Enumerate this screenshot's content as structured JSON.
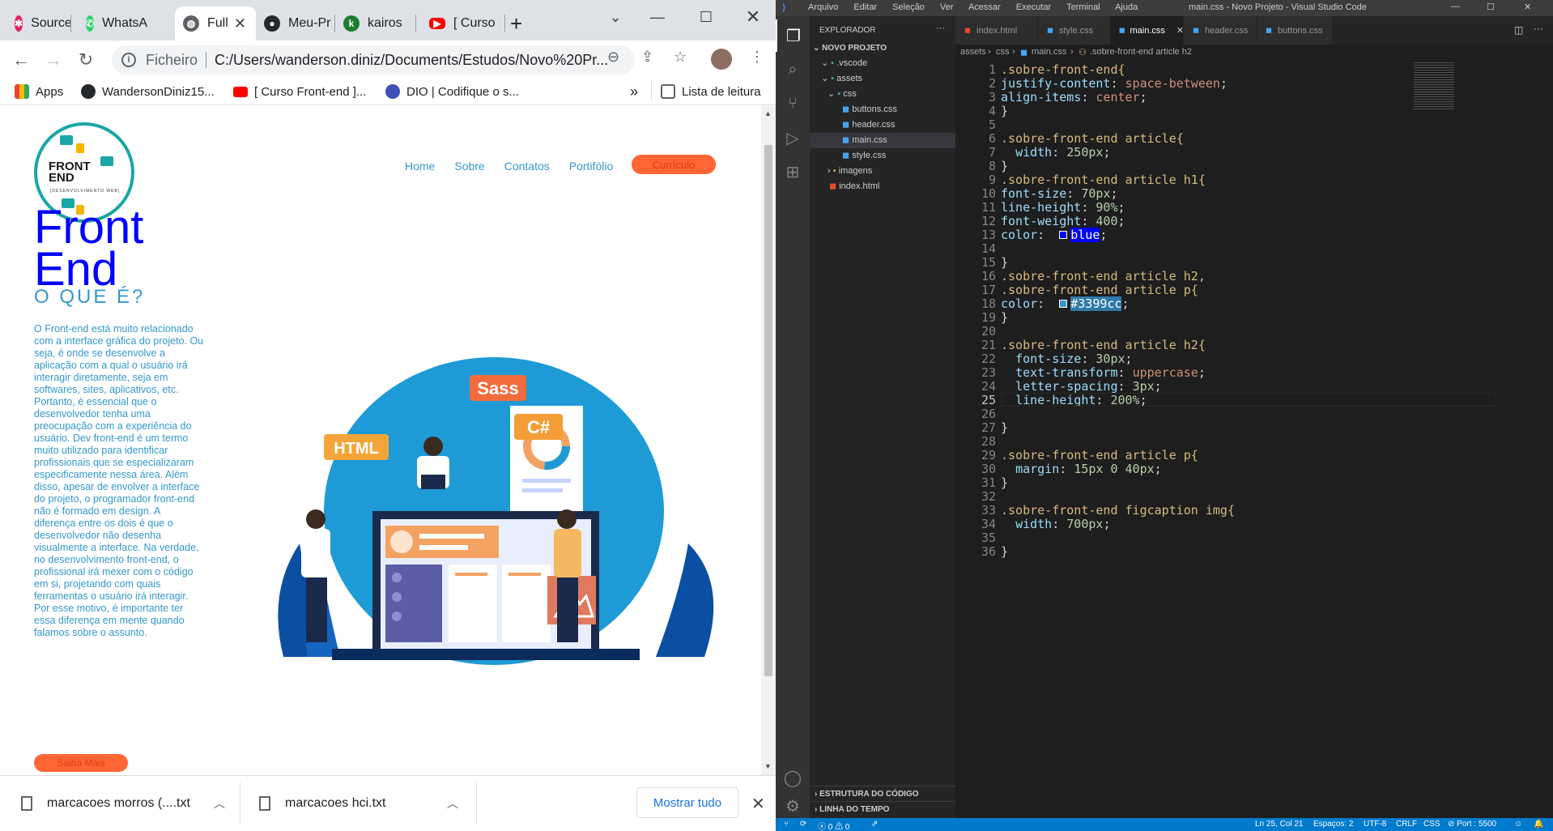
{
  "chrome": {
    "tabs": [
      {
        "label": "Source",
        "favicon": "slack-icon"
      },
      {
        "label": "WhatsA",
        "favicon": "whatsapp-icon"
      },
      {
        "label": "Full",
        "favicon": "globe-icon",
        "active": true
      },
      {
        "label": "Meu-Pr",
        "favicon": "github-icon"
      },
      {
        "label": "kairos",
        "favicon": "kairos-icon"
      },
      {
        "label": "[ Curso",
        "favicon": "youtube-icon"
      }
    ],
    "new_tab": "+",
    "address": {
      "scheme": "Ficheiro",
      "url": "C:/Users/wanderson.diniz/Documents/Estudos/Novo%20Pr..."
    },
    "bookmarks": {
      "apps": "Apps",
      "items": [
        "WandersonDiniz15...",
        "[ Curso Front-end ]...",
        "DIO | Codifique o s..."
      ],
      "more": "»",
      "reading_list": "Lista de leitura"
    }
  },
  "site": {
    "logo": {
      "line1": "FRONT",
      "line2": "END",
      "tagline": "[DESENVOLVIMENTO WEB]"
    },
    "nav": [
      "Home",
      "Sobre",
      "Contatos",
      "Portifólio"
    ],
    "cv_button": "Currículo",
    "title": "Front End",
    "subtitle": "O QUE É?",
    "paragraph": "O Front-end está muito relacionado com a interface gráfica do projeto. Ou seja, é onde se desenvolve a aplicação com a qual o usuário irá interagir diretamente, seja em softwares, sites, aplicativos, etc. Portanto, é essencial que o desenvolvedor tenha uma preocupação com a experiência do usuário. Dev front-end é um termo muito utilizado para identificar profissionais que se especializaram especificamente nessa área. Além disso, apesar de envolver a interface do projeto, o programador front-end não é formado em design. A diferença entre os dois é que o desenvolvedor não desenha visualmente a interface. Na verdade, no desenvolvimento front-end, o profissional irá mexer com o código em si, projetando com quais ferramentas o usuário irá interagir. Por esse motivo, é importante ter essa diferença em mente quando falamos sobre o assunto.",
    "more_button": "Saiba Mais",
    "illustration_labels": {
      "html": "HTML",
      "sass": "Sass",
      "csharp": "C#"
    }
  },
  "downloads": {
    "items": [
      "marcacoes morros (....txt",
      "marcacoes hci.txt"
    ],
    "show_all": "Mostrar tudo"
  },
  "vscode": {
    "menu": [
      "Arquivo",
      "Editar",
      "Seleção",
      "Ver",
      "Acessar",
      "Executar",
      "Terminal",
      "Ajuda"
    ],
    "window_title": "main.css - Novo Projeto - Visual Studio Code",
    "explorer_title": "EXPLORADOR",
    "project": "NOVO PROJETO",
    "tree": [
      ".vscode",
      "assets",
      "css",
      "buttons.css",
      "header.css",
      "main.css",
      "style.css",
      "imagens",
      "index.html"
    ],
    "tabs": [
      "index.html",
      "style.css",
      "main.css",
      "header.css",
      "buttons.css"
    ],
    "breadcrumb": [
      "assets",
      "css",
      "main.css",
      ".sobre-front-end article h2"
    ],
    "outline": "ESTRUTURA DO CÓDIGO",
    "timeline": "LINHA DO TEMPO",
    "status": {
      "position": "Ln 25, Col 21",
      "spaces": "Espaços: 2",
      "encoding": "UTF-8",
      "eol": "CRLF",
      "lang": "CSS",
      "port": "Port : 5500",
      "problems": "0",
      "warnings": "0"
    },
    "lines": [
      ".sobre-front-end{",
      "justify-content: space-between;",
      "align-items: center;",
      "}",
      "",
      ".sobre-front-end article{",
      "  width: 250px;",
      "}",
      ".sobre-front-end article h1{",
      "font-size: 70px;",
      "line-height: 90%;",
      "font-weight: 400;",
      "color:  blue;",
      "",
      "}",
      ".sobre-front-end article h2,",
      ".sobre-front-end article p{",
      "color:  #3399cc;",
      "}",
      "",
      ".sobre-front-end article h2{",
      "  font-size: 30px;",
      "  text-transform: uppercase;",
      "  letter-spacing: 3px;",
      "  line-height: 200%;",
      "",
      "}",
      "",
      ".sobre-front-end article p{",
      "  margin: 15px 0 40px;",
      "}",
      "",
      ".sobre-front-end figcaption img{",
      "  width: 700px;",
      "",
      "}"
    ]
  }
}
